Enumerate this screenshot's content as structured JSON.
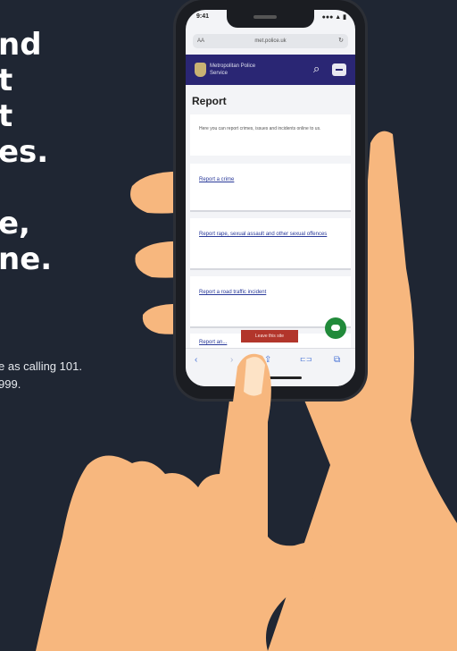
{
  "headline": {
    "lines": [
      "nd",
      "t",
      "t",
      "es.",
      "",
      "e,",
      "ne."
    ]
  },
  "subtext": {
    "lines": [
      "e as calling 101.",
      "999."
    ]
  },
  "phone": {
    "status_time": "9:41",
    "status_right": "●●● ▲ ▮",
    "url": "met.police.uk",
    "url_aa": "AA",
    "url_reload": "↻",
    "org_name": "Metropolitan Police",
    "org_sub": "Service",
    "page_title": "Report",
    "intro": "Here you can report crimes, issues and incidents online to us.",
    "cards": [
      "Report a crime",
      "Report rape, sexual assault and other sexual offences",
      "Report a road traffic incident",
      "Report an..."
    ],
    "leave_button": "Leave this site",
    "toolbar": [
      "‹",
      "›",
      "⇪",
      "⊏⊐",
      "⧉"
    ]
  },
  "colors": {
    "background": "#1f2633",
    "nav": "#2a2674",
    "skin": "#f7b77e",
    "chat": "#218a3a",
    "leave": "#b2352b"
  }
}
